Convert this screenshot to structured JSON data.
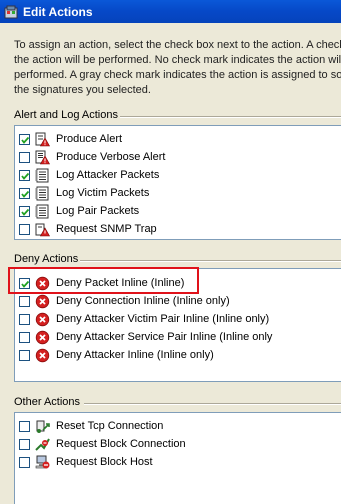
{
  "window": {
    "title": "Edit Actions"
  },
  "description": [
    "To assign an action, select the check box next to the action. A check",
    "the action will be performed. No check mark indicates the action will n",
    "performed. A gray check mark indicates the action is assigned to som",
    "the signatures you selected."
  ],
  "alert_log": {
    "title": "Alert and Log Actions",
    "items": [
      {
        "label": "Produce Alert",
        "checked": true,
        "icon": "alert-icon"
      },
      {
        "label": "Produce Verbose Alert",
        "checked": false,
        "icon": "verbose-alert-icon"
      },
      {
        "label": "Log Attacker Packets",
        "checked": true,
        "icon": "log-icon"
      },
      {
        "label": "Log Victim Packets",
        "checked": true,
        "icon": "log-icon"
      },
      {
        "label": "Log Pair Packets",
        "checked": true,
        "icon": "log-icon"
      },
      {
        "label": "Request SNMP Trap",
        "checked": false,
        "icon": "snmp-icon"
      }
    ]
  },
  "deny": {
    "title": "Deny Actions",
    "items": [
      {
        "label": "Deny Packet Inline (Inline)",
        "checked": true,
        "icon": "deny-icon"
      },
      {
        "label": "Deny Connection Inline (Inline only)",
        "checked": false,
        "icon": "deny-icon"
      },
      {
        "label": "Deny Attacker Victim Pair Inline (Inline only)",
        "checked": false,
        "icon": "deny-icon"
      },
      {
        "label": "Deny Attacker Service Pair Inline (Inline only",
        "checked": false,
        "icon": "deny-icon"
      },
      {
        "label": "Deny Attacker Inline (Inline only)",
        "checked": false,
        "icon": "deny-icon"
      }
    ]
  },
  "other": {
    "title": "Other Actions",
    "items": [
      {
        "label": "Reset Tcp Connection",
        "checked": false,
        "icon": "reset-icon"
      },
      {
        "label": "Request Block Connection",
        "checked": false,
        "icon": "block-connection-icon"
      },
      {
        "label": "Request Block Host",
        "checked": false,
        "icon": "block-host-icon"
      }
    ]
  },
  "colors": {
    "title_bar": "#0A58D8",
    "dialog_bg": "#ECE9D8",
    "highlight": "#E0121A",
    "deny_icon": "#D42020"
  }
}
